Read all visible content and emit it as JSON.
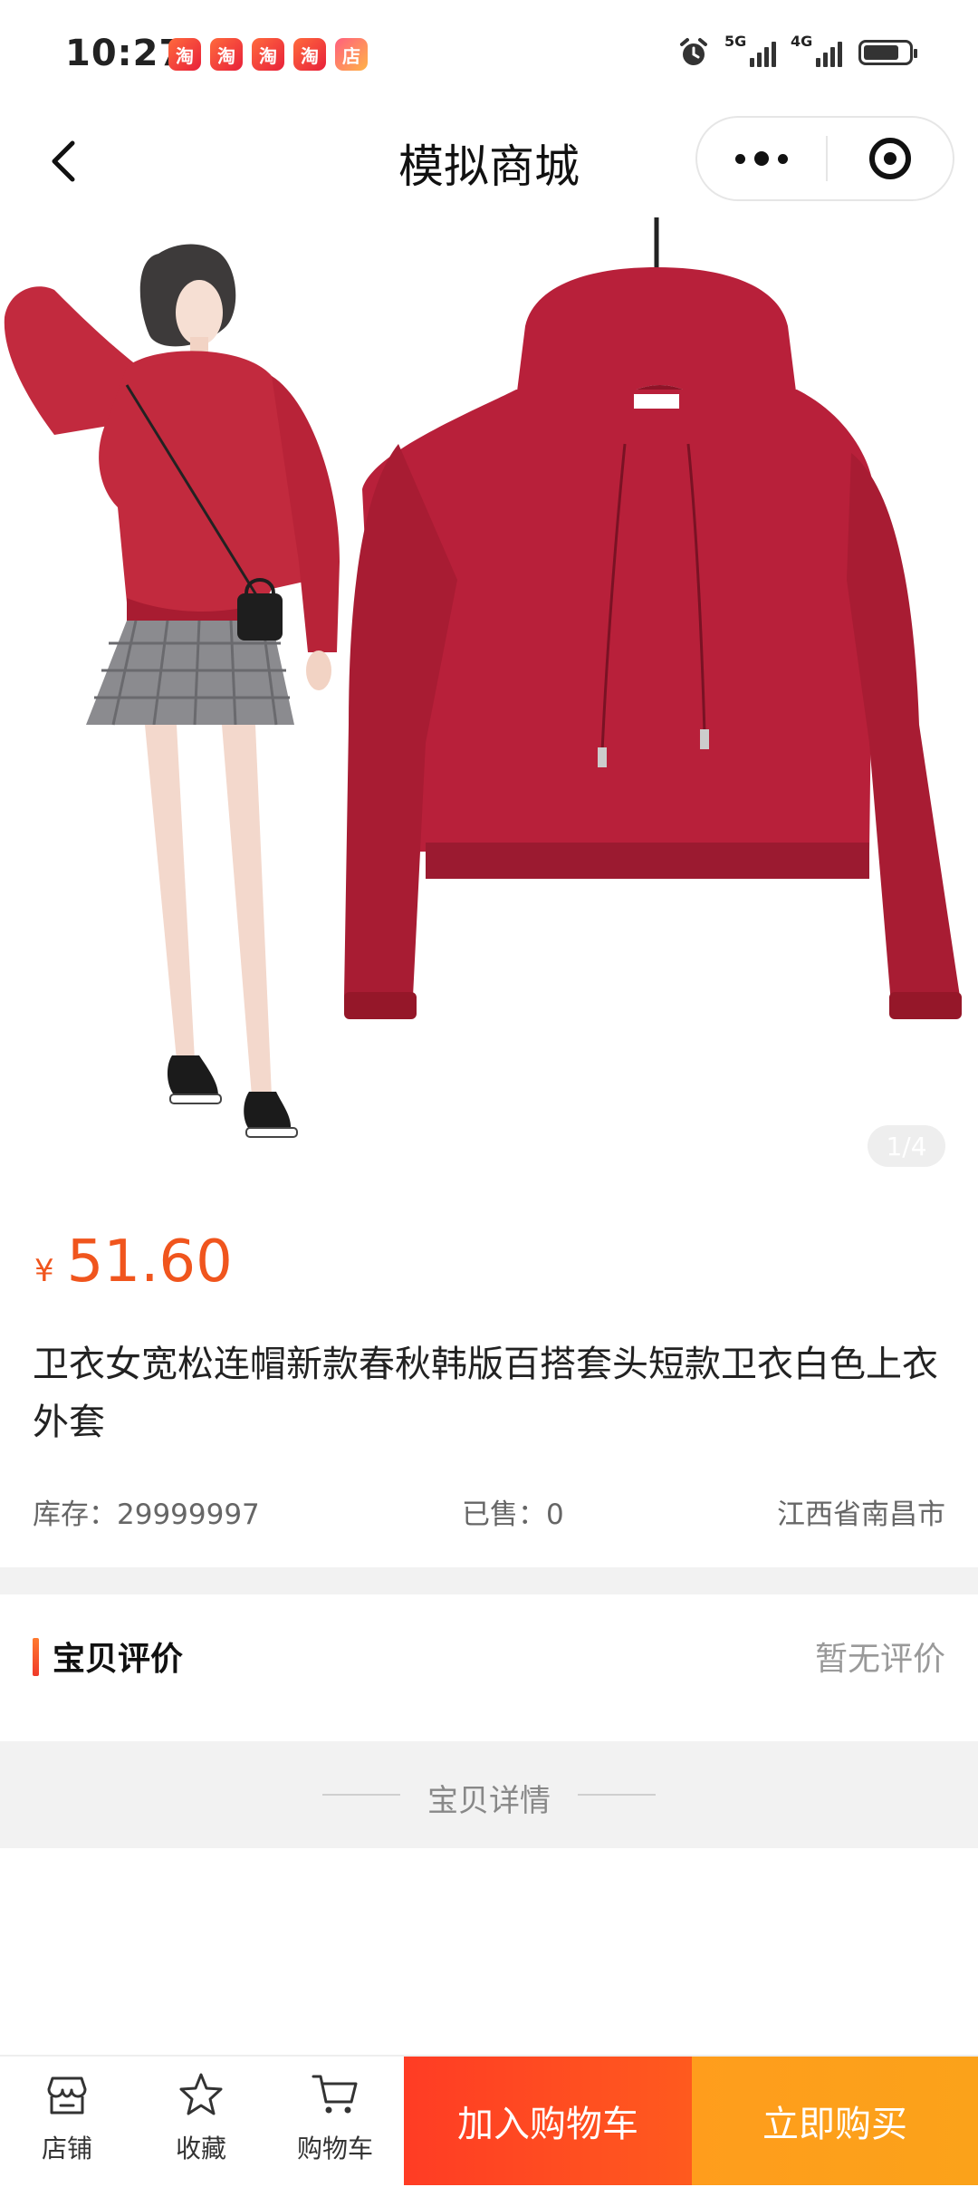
{
  "status_bar": {
    "time": "10:27",
    "app_icons": [
      "taobao-icon",
      "taobao-icon",
      "taobao-icon",
      "taobao-icon",
      "app-icon"
    ],
    "app_icon_glyphs": [
      "淘",
      "淘",
      "淘",
      "淘",
      "店"
    ],
    "network_1": "5G",
    "network_2": "4G"
  },
  "nav": {
    "title": "模拟商城"
  },
  "gallery": {
    "indicator": "1/4"
  },
  "product": {
    "currency_symbol": "¥",
    "price": "51.60",
    "title": "卫衣女宽松连帽新款春秋韩版百搭套头短款卫衣白色上衣外套",
    "stock_label": "库存：",
    "stock_value": "29999997",
    "sold_label": "已售：",
    "sold_value": "0",
    "location": "江西省南昌市"
  },
  "reviews": {
    "title": "宝贝评价",
    "empty_text": "暂无评价"
  },
  "details": {
    "title": "宝贝详情"
  },
  "bottom_bar": {
    "shop_label": "店铺",
    "favorite_label": "收藏",
    "cart_label": "购物车",
    "add_to_cart": "加入购物车",
    "buy_now": "立即购买"
  },
  "colors": {
    "price": "#f0551d",
    "add_to_cart_bg": "#ff4422",
    "buy_now_bg": "#fca01b",
    "product_color": "#b8203a"
  }
}
